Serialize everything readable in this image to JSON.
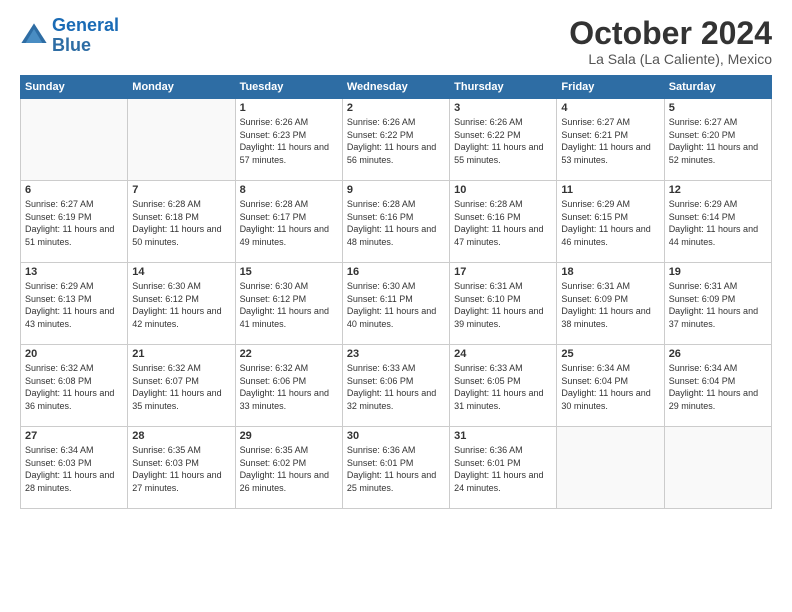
{
  "header": {
    "logo_line1": "General",
    "logo_line2": "Blue",
    "month_title": "October 2024",
    "location": "La Sala (La Caliente), Mexico"
  },
  "weekdays": [
    "Sunday",
    "Monday",
    "Tuesday",
    "Wednesday",
    "Thursday",
    "Friday",
    "Saturday"
  ],
  "weeks": [
    [
      {
        "day": "",
        "info": ""
      },
      {
        "day": "",
        "info": ""
      },
      {
        "day": "1",
        "info": "Sunrise: 6:26 AM\nSunset: 6:23 PM\nDaylight: 11 hours and 57 minutes."
      },
      {
        "day": "2",
        "info": "Sunrise: 6:26 AM\nSunset: 6:22 PM\nDaylight: 11 hours and 56 minutes."
      },
      {
        "day": "3",
        "info": "Sunrise: 6:26 AM\nSunset: 6:22 PM\nDaylight: 11 hours and 55 minutes."
      },
      {
        "day": "4",
        "info": "Sunrise: 6:27 AM\nSunset: 6:21 PM\nDaylight: 11 hours and 53 minutes."
      },
      {
        "day": "5",
        "info": "Sunrise: 6:27 AM\nSunset: 6:20 PM\nDaylight: 11 hours and 52 minutes."
      }
    ],
    [
      {
        "day": "6",
        "info": "Sunrise: 6:27 AM\nSunset: 6:19 PM\nDaylight: 11 hours and 51 minutes."
      },
      {
        "day": "7",
        "info": "Sunrise: 6:28 AM\nSunset: 6:18 PM\nDaylight: 11 hours and 50 minutes."
      },
      {
        "day": "8",
        "info": "Sunrise: 6:28 AM\nSunset: 6:17 PM\nDaylight: 11 hours and 49 minutes."
      },
      {
        "day": "9",
        "info": "Sunrise: 6:28 AM\nSunset: 6:16 PM\nDaylight: 11 hours and 48 minutes."
      },
      {
        "day": "10",
        "info": "Sunrise: 6:28 AM\nSunset: 6:16 PM\nDaylight: 11 hours and 47 minutes."
      },
      {
        "day": "11",
        "info": "Sunrise: 6:29 AM\nSunset: 6:15 PM\nDaylight: 11 hours and 46 minutes."
      },
      {
        "day": "12",
        "info": "Sunrise: 6:29 AM\nSunset: 6:14 PM\nDaylight: 11 hours and 44 minutes."
      }
    ],
    [
      {
        "day": "13",
        "info": "Sunrise: 6:29 AM\nSunset: 6:13 PM\nDaylight: 11 hours and 43 minutes."
      },
      {
        "day": "14",
        "info": "Sunrise: 6:30 AM\nSunset: 6:12 PM\nDaylight: 11 hours and 42 minutes."
      },
      {
        "day": "15",
        "info": "Sunrise: 6:30 AM\nSunset: 6:12 PM\nDaylight: 11 hours and 41 minutes."
      },
      {
        "day": "16",
        "info": "Sunrise: 6:30 AM\nSunset: 6:11 PM\nDaylight: 11 hours and 40 minutes."
      },
      {
        "day": "17",
        "info": "Sunrise: 6:31 AM\nSunset: 6:10 PM\nDaylight: 11 hours and 39 minutes."
      },
      {
        "day": "18",
        "info": "Sunrise: 6:31 AM\nSunset: 6:09 PM\nDaylight: 11 hours and 38 minutes."
      },
      {
        "day": "19",
        "info": "Sunrise: 6:31 AM\nSunset: 6:09 PM\nDaylight: 11 hours and 37 minutes."
      }
    ],
    [
      {
        "day": "20",
        "info": "Sunrise: 6:32 AM\nSunset: 6:08 PM\nDaylight: 11 hours and 36 minutes."
      },
      {
        "day": "21",
        "info": "Sunrise: 6:32 AM\nSunset: 6:07 PM\nDaylight: 11 hours and 35 minutes."
      },
      {
        "day": "22",
        "info": "Sunrise: 6:32 AM\nSunset: 6:06 PM\nDaylight: 11 hours and 33 minutes."
      },
      {
        "day": "23",
        "info": "Sunrise: 6:33 AM\nSunset: 6:06 PM\nDaylight: 11 hours and 32 minutes."
      },
      {
        "day": "24",
        "info": "Sunrise: 6:33 AM\nSunset: 6:05 PM\nDaylight: 11 hours and 31 minutes."
      },
      {
        "day": "25",
        "info": "Sunrise: 6:34 AM\nSunset: 6:04 PM\nDaylight: 11 hours and 30 minutes."
      },
      {
        "day": "26",
        "info": "Sunrise: 6:34 AM\nSunset: 6:04 PM\nDaylight: 11 hours and 29 minutes."
      }
    ],
    [
      {
        "day": "27",
        "info": "Sunrise: 6:34 AM\nSunset: 6:03 PM\nDaylight: 11 hours and 28 minutes."
      },
      {
        "day": "28",
        "info": "Sunrise: 6:35 AM\nSunset: 6:03 PM\nDaylight: 11 hours and 27 minutes."
      },
      {
        "day": "29",
        "info": "Sunrise: 6:35 AM\nSunset: 6:02 PM\nDaylight: 11 hours and 26 minutes."
      },
      {
        "day": "30",
        "info": "Sunrise: 6:36 AM\nSunset: 6:01 PM\nDaylight: 11 hours and 25 minutes."
      },
      {
        "day": "31",
        "info": "Sunrise: 6:36 AM\nSunset: 6:01 PM\nDaylight: 11 hours and 24 minutes."
      },
      {
        "day": "",
        "info": ""
      },
      {
        "day": "",
        "info": ""
      }
    ]
  ]
}
